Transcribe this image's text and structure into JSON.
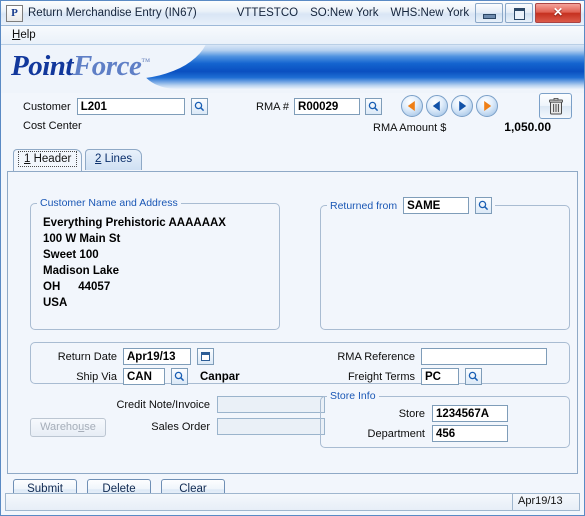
{
  "window": {
    "app_glyph": "P",
    "title": "Return Merchandise Entry (IN67)",
    "company": "VTTESTCO",
    "sales_office": "SO:New York",
    "warehouse": "WHS:New York",
    "minimize_label": "Minimize",
    "restore_label": "Restore",
    "close_glyph": "✕"
  },
  "menu": {
    "items": [
      {
        "label": "Help",
        "accel": "H"
      }
    ]
  },
  "banner": {
    "logo_first": "Point",
    "logo_second": "Force",
    "logo_tm": "™"
  },
  "header": {
    "customer_label": "Customer",
    "customer_value": "L201",
    "cost_center_label": "Cost Center",
    "rma_label": "RMA #",
    "rma_value": "R00029",
    "rma_amount_label": "RMA Amount $",
    "rma_amount_value": "1,050.00",
    "nav": {
      "first_title": "First",
      "prev_title": "Previous",
      "next_title": "Next",
      "last_title": "Last",
      "delete_title": "Delete"
    }
  },
  "tabs": [
    {
      "num": "1",
      "label": "Header",
      "active": true
    },
    {
      "num": "2",
      "label": "Lines",
      "active": false
    }
  ],
  "customer_address": {
    "legend": "Customer Name and Address",
    "name": "Everything Prehistoric AAAAAAX",
    "street": "100 W Main St",
    "unit": "Sweet 100",
    "city": "Madison Lake",
    "state": "OH",
    "zip": "44057",
    "country": "USA"
  },
  "returned_from": {
    "legend": "Returned from",
    "value": "SAME"
  },
  "details": {
    "return_date_label": "Return Date",
    "return_date_value": "Apr19/13",
    "ship_via_label": "Ship Via",
    "ship_via_value": "CAN",
    "ship_via_desc": "Canpar",
    "rma_reference_label": "RMA Reference",
    "rma_reference_value": "",
    "freight_terms_label": "Freight Terms",
    "freight_terms_value": "PC"
  },
  "lower": {
    "warehouse_label": "Warehouse",
    "warehouse_accel": "u",
    "credit_note_label": "Credit Note/Invoice",
    "credit_note_value": "",
    "sales_order_label": "Sales Order",
    "sales_order_value": ""
  },
  "store_info": {
    "legend": "Store Info",
    "store_label": "Store",
    "store_value": "1234567A",
    "department_label": "Department",
    "department_value": "456"
  },
  "buttons": [
    {
      "label": "Submit",
      "accel": "u"
    },
    {
      "label": "Delete",
      "accel": "D"
    },
    {
      "label": "Clear",
      "accel": ""
    }
  ],
  "statusbar": {
    "message": "",
    "date": "Apr19/13"
  },
  "colors": {
    "banner_blue": "#0a4fc0",
    "logo_dark": "#12389c",
    "logo_light": "#5f7fc6",
    "legend_blue": "#1a57b5",
    "nav_orange": "#ef7f16",
    "nav_blue": "#1252a8",
    "close_red": "#c5301f",
    "panel_bg": "#f2f6fc"
  }
}
